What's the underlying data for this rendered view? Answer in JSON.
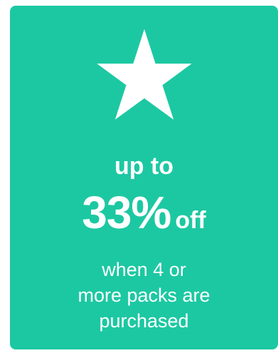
{
  "promo": {
    "icon": "star-icon",
    "background_color": "#1cc8a2",
    "text_color": "#ffffff",
    "headline": "up to",
    "discount_value": "33%",
    "discount_suffix": "off",
    "terms_lines": [
      "when 4 or",
      "more packs are",
      "purchased"
    ]
  }
}
